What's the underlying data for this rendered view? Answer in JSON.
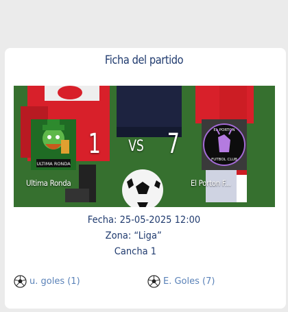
{
  "match": {
    "title": "Ficha del partido",
    "vs_label": "VS",
    "home": {
      "name": "Ultima Ronda",
      "score": "1",
      "crest_text": "ULTIMA RONDA",
      "goals_label": "u. goles (1)"
    },
    "away": {
      "name": "El Porton F...",
      "score": "7",
      "crest_text_top": "EL PORTON",
      "crest_text_bottom": "FUTBOL CLUB",
      "goals_label": "E. Goles (7)"
    },
    "fecha": "Fecha: 25-05-2025 12:00",
    "zona": "Zona: “Liga”",
    "cancha": "Cancha 1"
  },
  "icons": {
    "goal": "soccer-ball-icon"
  },
  "colors": {
    "title": "#1f3a6e",
    "goals_text": "#5a82b8",
    "card_bg": "#ffffff",
    "page_bg": "#ebebeb"
  }
}
